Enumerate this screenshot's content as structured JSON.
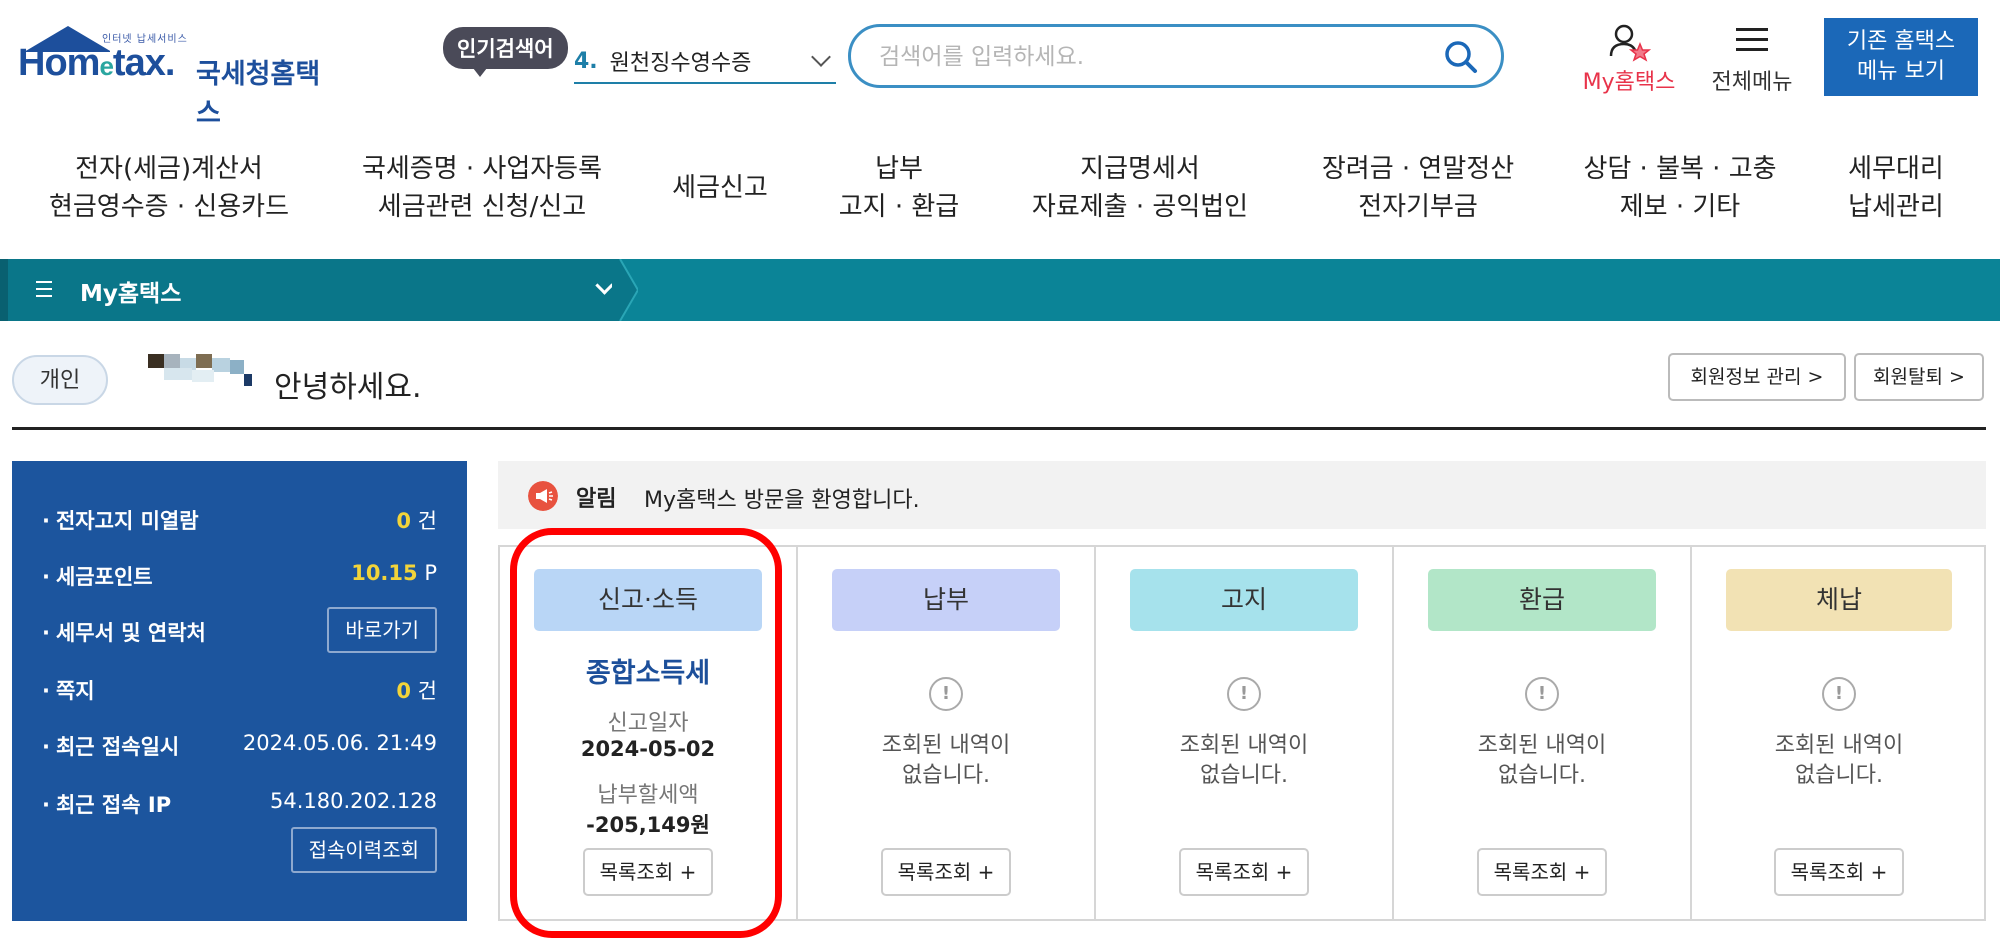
{
  "header": {
    "logo_small": "인터넷 납세서비스",
    "logo_en_prefix": "Hom",
    "logo_en_e": "e",
    "logo_en_suffix": "tax.",
    "logo_kr": "국세청홈택스",
    "popular_badge": "인기검색어",
    "popular_keyword_rank": "4.",
    "popular_keyword": "원천징수영수증",
    "search_placeholder": "검색어를 입력하세요.",
    "my_hometax": "My홈택스",
    "full_menu": "전체메뉴",
    "old_menu_line1": "기존 홈택스",
    "old_menu_line2": "메뉴 보기"
  },
  "nav": [
    {
      "line1": "전자(세금)계산서",
      "line2": "현금영수증 · 신용카드"
    },
    {
      "line1": "국세증명 · 사업자등록",
      "line2": "세금관련 신청/신고"
    },
    {
      "line1": "세금신고",
      "line2": ""
    },
    {
      "line1": "납부",
      "line2": "고지 · 환급"
    },
    {
      "line1": "지급명세서",
      "line2": "자료제출 · 공익법인"
    },
    {
      "line1": "장려금 · 연말정산",
      "line2": "전자기부금"
    },
    {
      "line1": "상담 · 불복 · 고충",
      "line2": "제보 · 기타"
    },
    {
      "line1": "세무대리",
      "line2": "납세관리"
    }
  ],
  "section_bar": {
    "title": "My홈택스"
  },
  "greeting": {
    "type_badge": "개인",
    "text": "안녕하세요.",
    "member_info_btn": "회원정보 관리 >",
    "withdraw_btn": "회원탈퇴 >"
  },
  "info_panel": {
    "rows": [
      {
        "label": "전자고지 미열람",
        "value": "0",
        "unit": "건"
      },
      {
        "label": "세금포인트",
        "value": "10.15",
        "unit": "P"
      },
      {
        "label": "세무서 및 연락처",
        "button": "바로가기"
      },
      {
        "label": "쪽지",
        "value": "0",
        "unit": "건"
      },
      {
        "label": "최근 접속일시",
        "text": "2024.05.06.  21:49"
      },
      {
        "label": "최근 접속 IP",
        "text": "54.180.202.128",
        "button": "접속이력조회"
      }
    ],
    "bullet": "·"
  },
  "alert": {
    "label": "알림",
    "text": "My홈택스 방문을 환영합니다."
  },
  "cards": [
    {
      "title": "신고·소득",
      "color": "#b9d6f6",
      "subject": "종합소득세",
      "date_label": "신고일자",
      "date_value": "2024-05-02",
      "tax_label": "납부할세액",
      "tax_value": "-205,149원",
      "button": "목록조회 +"
    },
    {
      "title": "납부",
      "color": "#c6d0f8",
      "empty_icon": "!",
      "empty_line1": "조회된 내역이",
      "empty_line2": "없습니다.",
      "button": "목록조회 +"
    },
    {
      "title": "고지",
      "color": "#a6e2ec",
      "empty_icon": "!",
      "empty_line1": "조회된 내역이",
      "empty_line2": "없습니다.",
      "button": "목록조회 +"
    },
    {
      "title": "환급",
      "color": "#b2e6c8",
      "empty_icon": "!",
      "empty_line1": "조회된 내역이",
      "empty_line2": "없습니다.",
      "button": "목록조회 +"
    },
    {
      "title": "체납",
      "color": "#f2e2b4",
      "empty_icon": "!",
      "empty_line1": "조회된 내역이",
      "empty_line2": "없습니다.",
      "button": "목록조회 +"
    }
  ],
  "colors": {
    "brand_blue": "#1d4f9c",
    "teal_bar": "#0b8497",
    "panel_blue": "#1c559e",
    "accent_red": "#e8334a",
    "highlight": "#ff0000"
  }
}
